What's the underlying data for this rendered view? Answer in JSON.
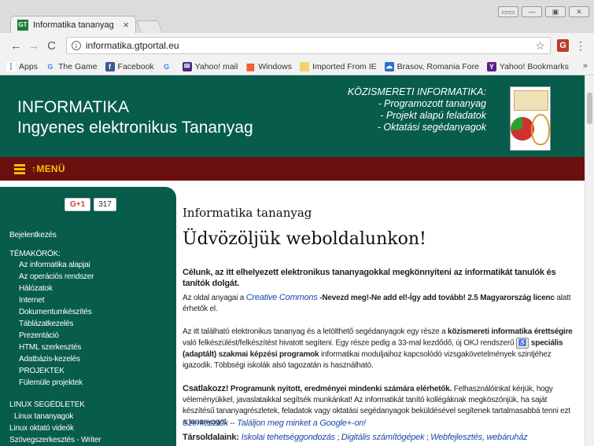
{
  "browser": {
    "tab_title": "Informatika tananyag",
    "tab_close": "×",
    "tab_favicon": "GT",
    "url": "informatika.gtportal.eu",
    "nav": {
      "back": "←",
      "forward": "→",
      "reload": "C"
    },
    "win_controls": [
      "▭▭",
      "—",
      "▣",
      "✕"
    ],
    "ext_label": "G"
  },
  "bookmarks": {
    "items": [
      {
        "label": "Apps",
        "icon": "apps-grid-icon",
        "color": "#4285f4",
        "glyph": "⁞"
      },
      {
        "label": "The Game",
        "icon": "google-g-icon",
        "color": "#ffffff",
        "glyph": "G"
      },
      {
        "label": "Facebook",
        "icon": "facebook-icon",
        "color": "#3b5998",
        "glyph": "f"
      },
      {
        "label": "",
        "icon": "google-g-icon",
        "color": "#ffffff",
        "glyph": "G"
      },
      {
        "label": "Yahoo! mail",
        "icon": "mail-icon",
        "color": "#4a2c7a",
        "glyph": "✉"
      },
      {
        "label": "Windows",
        "icon": "windows-icon",
        "color": "#f25022",
        "glyph": "▦"
      },
      {
        "label": "Imported From IE",
        "icon": "folder-icon",
        "color": "#f3d36b",
        "glyph": ""
      },
      {
        "label": "Brasov, Romania Fore",
        "icon": "weather-icon",
        "color": "#2a6fc9",
        "glyph": "☁"
      },
      {
        "label": "Yahoo! Bookmarks",
        "icon": "yahoo-icon",
        "color": "#5a1e8a",
        "glyph": "Y"
      }
    ],
    "more": "»"
  },
  "header": {
    "title": "INFORMATIKA",
    "subtitle": "Ingyenes elektronikus Tananyag",
    "promo_heading": "KÖZISMERETI INFORMATIKA:",
    "promo_lines": [
      "- Programozott tananyag",
      "- Projekt alapú feladatok",
      "- Oktatási segédanyagok"
    ]
  },
  "menu": {
    "label": "MENÜ",
    "arrow": "↑"
  },
  "sidebar": {
    "gplus_label": "G+1",
    "gplus_count": "317",
    "login": "Bejelentkezés",
    "topics_heading": "TÉMAKÖRÖK:",
    "topics": [
      "Az informatika alapjai",
      "Az operációs rendszer",
      "Hálózatok",
      "Internet",
      "Dokumentumkészítés",
      "Táblázatkezelés",
      "Prezentáció",
      "HTML szerkesztés",
      "Adatbázis-kezelés",
      "PROJEKTEK",
      "Fülemüle projektek"
    ],
    "linux_heading": "LINUX SEGÉDLETEK",
    "linux_items": [
      "Linux tananyagok",
      "Linux oktató videók",
      "Szövegszerkesztés - Writer"
    ]
  },
  "content": {
    "title": "Informatika tananyag",
    "welcome": "Üdvözöljük weboldalunkon!",
    "goal": "Célunk, az itt elhelyezett elektronikus tananyagokkal megkönnyiteni az informatikát tanulók és tanítók dolgát.",
    "license_pre": "Az oldal anyagai a ",
    "license_link": "Creative Commons",
    "license_mid": " -Nevezd meg!-Ne add el!-Így add tovább! 2.5 Magyarország licenc",
    "license_post": " alatt érhetők el.",
    "desc_1": "Az itt található elektronikus tananyag és a letölthető segédanyagok egy része a ",
    "desc_bold_1": "közismereti informatika érettségire",
    "desc_2": " való felkészülést/felkészítést hivatott segíteni. Egy része pedig a 33-mal kezdődő, új OKJ rendszerű ",
    "desc_bold_2": "speciális (adaptált) szakmai képzési programok",
    "desc_3": " informatikai moduljaihoz kapcsolódó vizsgakövetelmények szintjéhez igazodik. Többségi iskolák alsó tagozatán is használható.",
    "join_bold": "Csatlakozz!",
    "join_rest_bold": " Programunk nyitott, eredményei mindenki számára elérhetők.",
    "join_text": " Felhasználóinkat kérjük, hogy véleményükkel, javaslataikkal segítsék munkánkat! Az informatikát tanító kollégáknak megköszönjük, ha saját készítésű tananyagrészletek, feladatok vagy oktatási segédanyagok beküldésével segítenek tartalmasabbá tenni ezt a tananyagot.",
    "authors_link": "Szerkesztők",
    "authors_sep": " -- ",
    "gplus_link": "Találjon meg minket a Google+-on!",
    "partners_label": "Társoldalaink: ",
    "partner_1": "Iskolai tehetséggondozás",
    "partner_sep_1": " ; ",
    "partner_2": "Digitális számítógépek",
    "partner_sep_2": " ; ",
    "partner_3": "Webfejlesztés, webáruház"
  }
}
